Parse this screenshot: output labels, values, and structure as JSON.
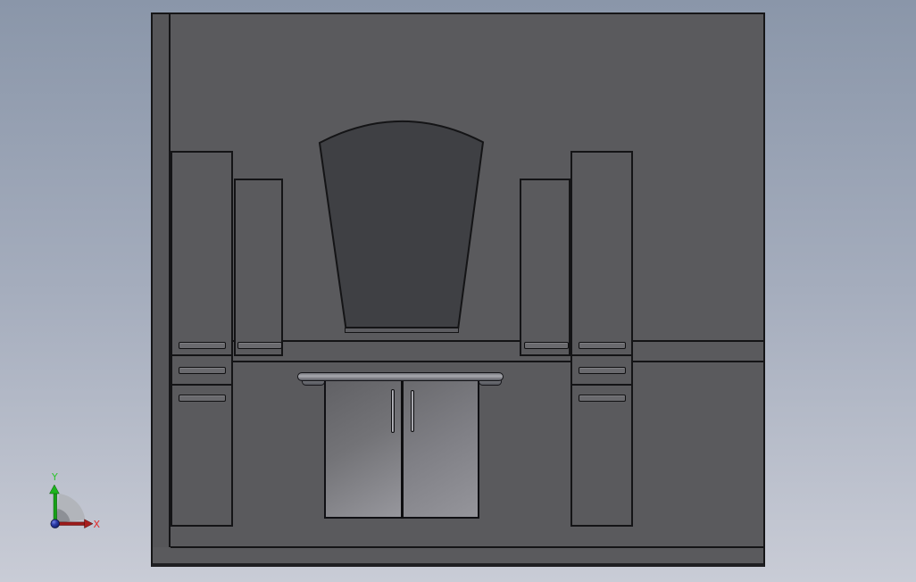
{
  "viewport": {
    "background_top": "#8a96a9",
    "background_bottom": "#c9ccd6"
  },
  "triad": {
    "y_label": "Y",
    "x_label": "X",
    "y_axis_color": "#21b421",
    "x_axis_color": "#a81e1e",
    "x_label_color": "#e22b2b",
    "y_label_color": "#2cc42c",
    "origin_sphere_color": "#1c2d8c",
    "fan_color": "#b2b5bb"
  },
  "model": {
    "panel_color": "#5a5a5d",
    "side_panel_color": "#565659",
    "outline_color": "#141416",
    "mirror_color": "#3f4044",
    "door_gradient_light": "#97979d",
    "door_gradient_dark": "#616165",
    "rail_highlight": "#a8a9af",
    "parts": [
      "back-panel",
      "side-panel",
      "left-tall-cabinet",
      "left-upper-cabinet",
      "arched-mirror",
      "mirror-shelf",
      "right-upper-cabinet",
      "right-tall-cabinet",
      "towel-rail",
      "base-cabinet",
      "counter-edge",
      "floor-edge"
    ]
  }
}
